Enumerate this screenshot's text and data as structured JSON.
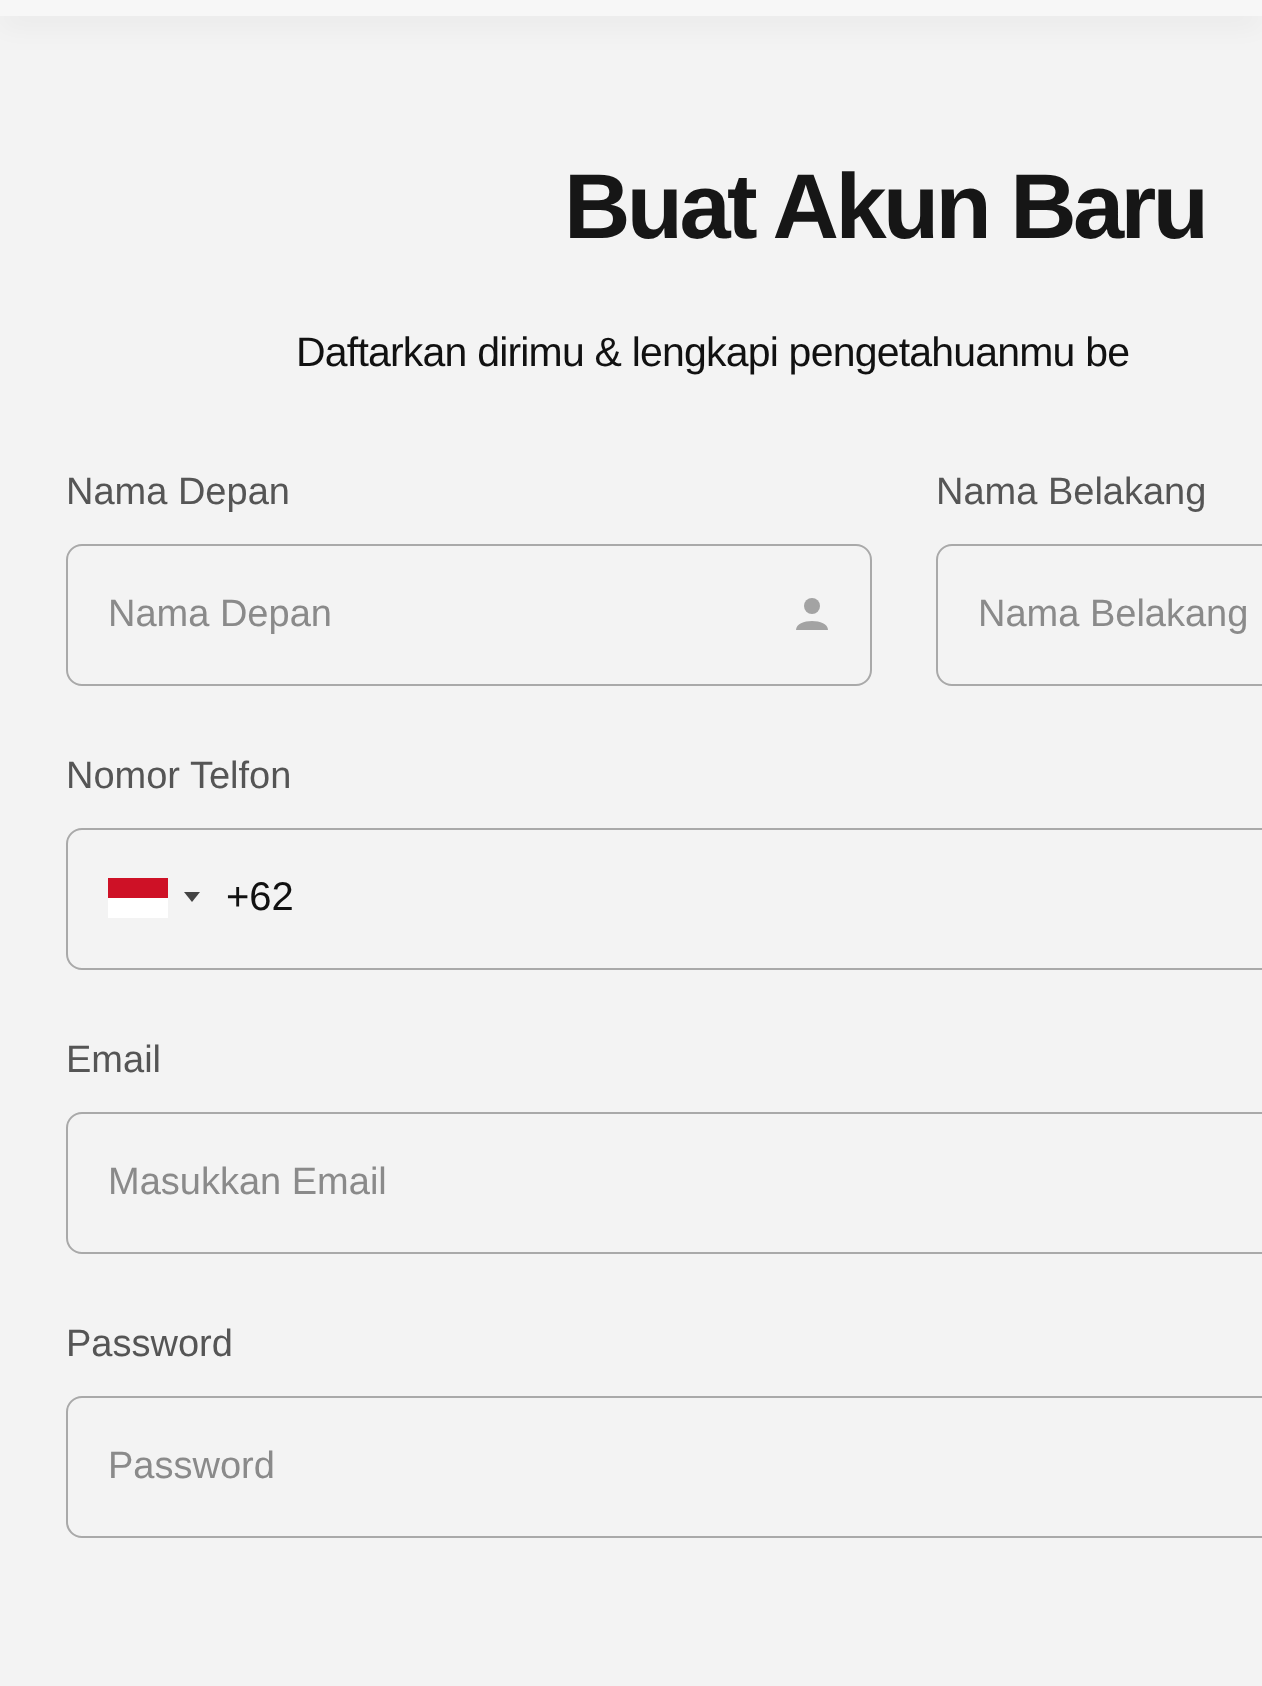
{
  "title": "Buat Akun Baru",
  "subtitle": "Daftarkan dirimu & lengkapi pengetahuanmu be",
  "rows": [
    {
      "fields": [
        {
          "kind": "name",
          "label": "Nama Depan",
          "placeholder": "Nama Depan"
        },
        {
          "kind": "plain",
          "label": "Nama Belakang",
          "placeholder": "Nama Belakang"
        }
      ]
    },
    {
      "fields": [
        {
          "kind": "phone",
          "label": "Nomor Telfon",
          "value": "+62"
        }
      ]
    },
    {
      "fields": [
        {
          "kind": "plain",
          "label": "Email",
          "placeholder": "Masukkan Email"
        }
      ]
    },
    {
      "fields": [
        {
          "kind": "plain",
          "label": "Password",
          "placeholder": "Password"
        }
      ]
    }
  ]
}
